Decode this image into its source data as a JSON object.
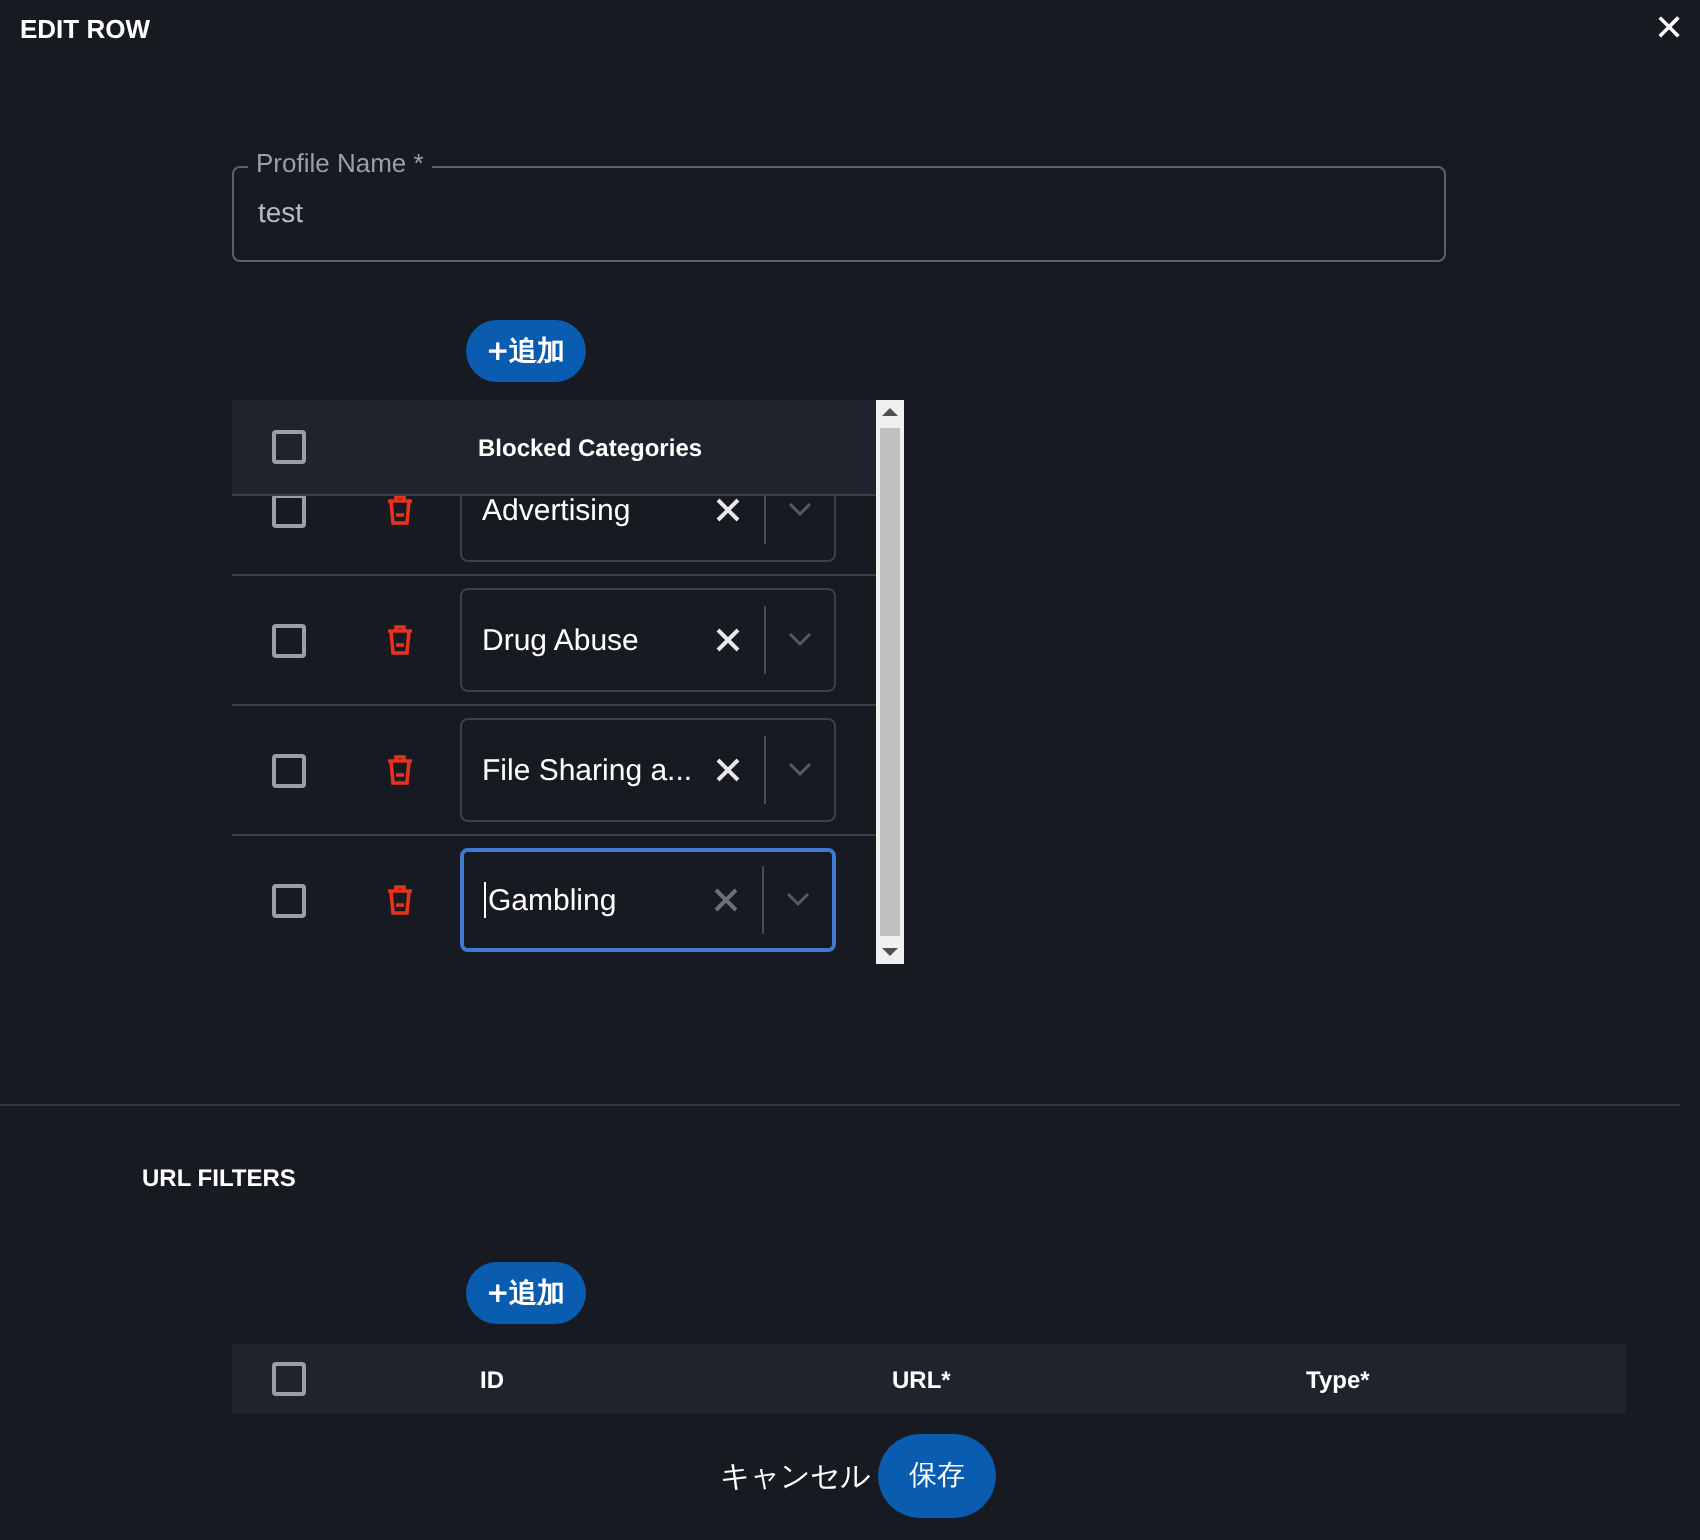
{
  "dialog": {
    "title": "EDIT ROW",
    "close": "✕"
  },
  "profile_name": {
    "label": "Profile Name *",
    "value": "test"
  },
  "categories": {
    "add_button": "+追加",
    "header": {
      "checked": false,
      "column": "Blocked Categories"
    },
    "rows": [
      {
        "checked": false,
        "value": "Advertising",
        "focused": false
      },
      {
        "checked": false,
        "value": "Drug Abuse",
        "focused": false
      },
      {
        "checked": false,
        "value": "File Sharing a...",
        "focused": false
      },
      {
        "checked": false,
        "value": "Gambling",
        "focused": true
      }
    ]
  },
  "url_filters": {
    "title": "URL FILTERS",
    "add_button": "+追加",
    "header": {
      "checked": false,
      "columns": [
        "ID",
        "URL*",
        "Type*"
      ]
    }
  },
  "footer": {
    "cancel": "キャンセル",
    "save": "保存"
  }
}
